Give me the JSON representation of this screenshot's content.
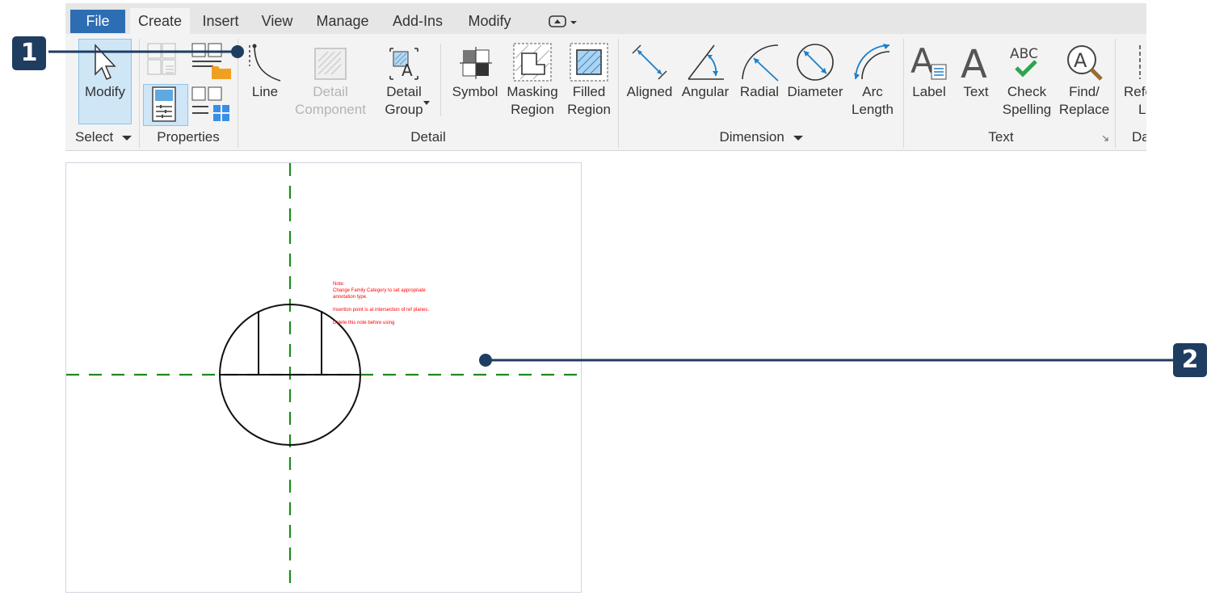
{
  "ribbon": {
    "tabs": [
      "File",
      "Create",
      "Insert",
      "View",
      "Manage",
      "Add-Ins",
      "Modify"
    ],
    "active_tab": "Create",
    "select_panel": {
      "modify_label": "Modify",
      "panel_label": "Select",
      "dropdown_icon": "chevron-down-icon"
    },
    "properties_panel": {
      "panel_label": "Properties"
    },
    "detail_panel": {
      "line_label": "Line",
      "detail_component_label": [
        "Detail",
        "Component"
      ],
      "detail_group_label": [
        "Detail",
        "Group"
      ],
      "symbol_label": "Symbol",
      "masking_region_label": [
        "Masking",
        "Region"
      ],
      "filled_region_label": [
        "Filled",
        "Region"
      ],
      "panel_label": "Detail"
    },
    "dimension_panel": {
      "aligned_label": "Aligned",
      "angular_label": "Angular",
      "radial_label": "Radial",
      "diameter_label": "Diameter",
      "arc_length_label": [
        "Arc",
        "Length"
      ],
      "panel_label": "Dimension"
    },
    "text_panel": {
      "label_label": "Label",
      "text_label": "Text",
      "check_spelling_label": [
        "Check",
        "Spelling"
      ],
      "check_spelling_icon_text": "ABC",
      "find_replace_label": [
        "Find/",
        "Replace"
      ],
      "panel_label": "Text"
    },
    "datum_panel": {
      "ref_label": [
        "Refe",
        "L"
      ],
      "panel_label": "Da"
    }
  },
  "canvas": {
    "notes": [
      "Note:",
      "Change Family Category to set appropriate",
      "annotation type.",
      "",
      "Insertion point is at intersection of ref planes.",
      "",
      "Delete this note before using"
    ]
  },
  "callouts": {
    "one": "1",
    "two": "2"
  },
  "colors": {
    "file_tab": "#2d6db4",
    "callout": "#1f3d60",
    "ref_plane": "#1f8a1f",
    "note_text": "#ff0000"
  }
}
